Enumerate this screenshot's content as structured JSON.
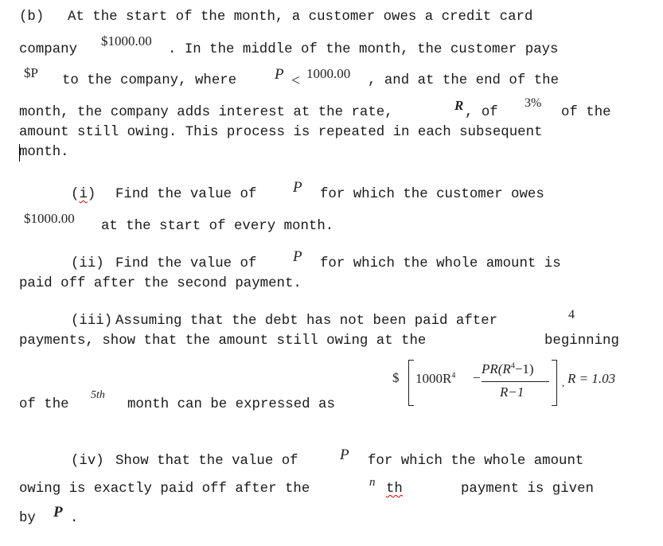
{
  "part_label": "(b)",
  "intro": {
    "line1": "At the start of the month, a customer owes a credit card",
    "line2_a": "company",
    "amount_owed": "$1000.00",
    "line2_b": ". In the middle of the month, the customer pays",
    "payment_var": "$P",
    "line3_a": "to the company, where",
    "P": "P",
    "less_than": "<",
    "limit": "1000.00",
    "line3_b": ", and at the end of the",
    "line4_a": "month, the company adds interest at the rate,",
    "R": "R",
    "line4_b": ", of",
    "rate": "3%",
    "line4_c": "of the",
    "line5": "amount still owing. This process is repeated in each subsequent",
    "line6": "month."
  },
  "part_i": {
    "label": "(i)",
    "text_a": "Find the value of",
    "var": "P",
    "text_b": "for which the customer owes",
    "amount": "$1000.00",
    "text_c": "at the start of every month."
  },
  "part_ii": {
    "label": "(ii)",
    "text_a": "Find the value of",
    "var": "P",
    "text_b": "for which the whole amount is",
    "text_c": "paid off after the second payment."
  },
  "part_iii": {
    "label": "(iii)",
    "text_a": "Assuming that the debt has not been paid after",
    "count": "4",
    "text_b": "payments, show that the amount still owing at the",
    "text_c": "beginning",
    "text_d": "of the",
    "month_ordinal": "5th",
    "text_e": "month can be expressed as",
    "formula": {
      "currency": "$",
      "term1": "1000R",
      "term1_exp": "4",
      "minus": "−",
      "numerator": "PR(R",
      "numerator_exp": "4",
      "numerator_tail": "−1)",
      "denominator": "R−1",
      "comma": ",",
      "condition": "R = 1.03"
    }
  },
  "part_iv": {
    "label": "(iv)",
    "text_a": "Show that the value of",
    "var": "P",
    "text_b": "for which the whole amount",
    "text_c": "owing is exactly paid off after the",
    "n": "n",
    "th": "th",
    "text_d": "payment is given",
    "text_e": "by",
    "result_var": "P",
    "period": "."
  }
}
